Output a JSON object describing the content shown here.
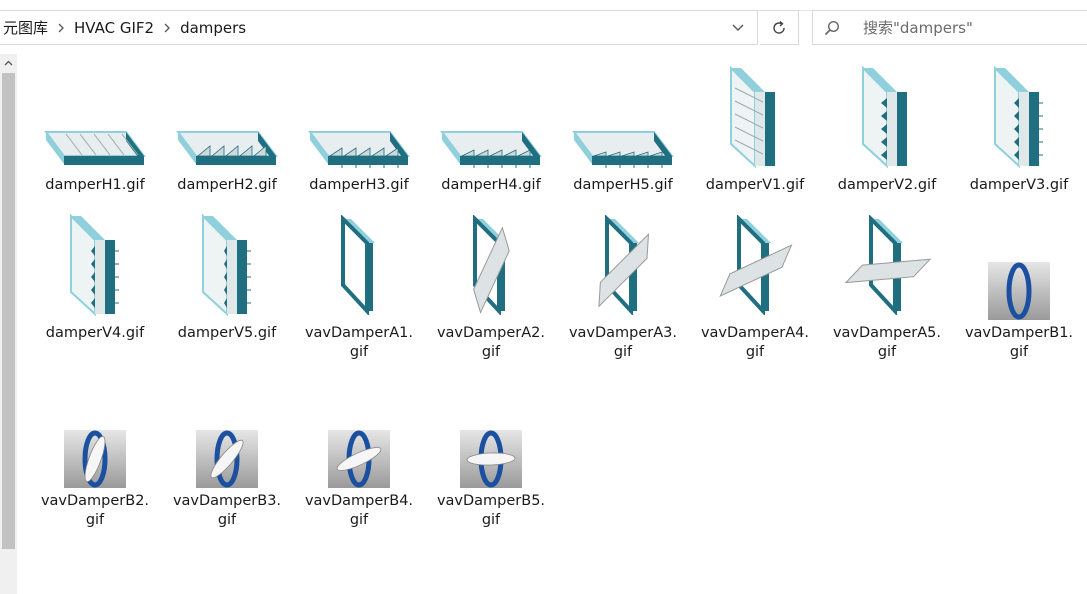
{
  "breadcrumb": [
    "元图库",
    "HVAC GIF2",
    "dampers"
  ],
  "search": {
    "placeholder": "搜索\"dampers\""
  },
  "files": [
    {
      "name": "damperH1.gif",
      "kind": "h",
      "n": 1
    },
    {
      "name": "damperH2.gif",
      "kind": "h",
      "n": 2
    },
    {
      "name": "damperH3.gif",
      "kind": "h",
      "n": 3
    },
    {
      "name": "damperH4.gif",
      "kind": "h",
      "n": 4
    },
    {
      "name": "damperH5.gif",
      "kind": "h",
      "n": 5
    },
    {
      "name": "damperV1.gif",
      "kind": "v",
      "n": 1
    },
    {
      "name": "damperV2.gif",
      "kind": "v",
      "n": 2
    },
    {
      "name": "damperV3.gif",
      "kind": "v",
      "n": 3
    },
    {
      "name": "damperV4.gif",
      "kind": "v",
      "n": 4
    },
    {
      "name": "damperV5.gif",
      "kind": "v",
      "n": 5
    },
    {
      "name": "vavDamperA1.gif",
      "kind": "a",
      "n": 1
    },
    {
      "name": "vavDamperA2.gif",
      "kind": "a",
      "n": 2
    },
    {
      "name": "vavDamperA3.gif",
      "kind": "a",
      "n": 3
    },
    {
      "name": "vavDamperA4.gif",
      "kind": "a",
      "n": 4
    },
    {
      "name": "vavDamperA5.gif",
      "kind": "a",
      "n": 5
    },
    {
      "name": "vavDamperB1.gif",
      "kind": "b",
      "n": 1
    },
    {
      "name": "vavDamperB2.gif",
      "kind": "b",
      "n": 2
    },
    {
      "name": "vavDamperB3.gif",
      "kind": "b",
      "n": 3
    },
    {
      "name": "vavDamperB4.gif",
      "kind": "b",
      "n": 4
    },
    {
      "name": "vavDamperB5.gif",
      "kind": "b",
      "n": 5
    }
  ],
  "colors": {
    "teal": "#1f6f80",
    "teal_light": "#8fd0dc",
    "blue": "#1b4fa0"
  }
}
